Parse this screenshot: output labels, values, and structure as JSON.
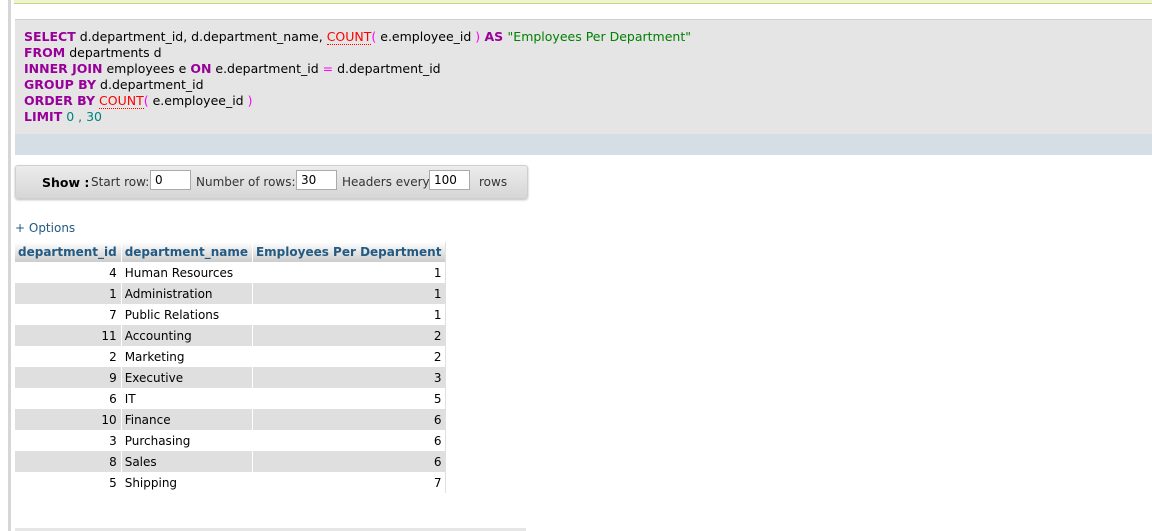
{
  "sql": {
    "line1": {
      "kw_select": "SELECT",
      "cols": " d.department_id, d.department_name, ",
      "fn_count": "COUNT",
      "paren_open": "( ",
      "arg": "e.employee_id",
      "paren_close": " )",
      "kw_as": " AS ",
      "alias": "\"Employees Per Department\""
    },
    "line2": {
      "kw_from": "FROM",
      "rest": " departments d"
    },
    "line3": {
      "kw_inner_join": "INNER JOIN",
      "rest1": " employees e ",
      "kw_on": "ON",
      "rest2": " e.department_id ",
      "op_eq": "=",
      "rest3": " d.department_id"
    },
    "line4": {
      "kw_group_by": "GROUP BY",
      "rest": " d.department_id"
    },
    "line5": {
      "kw_order_by": "ORDER BY",
      "space": " ",
      "fn_count": "COUNT",
      "paren_open": "( ",
      "arg": "e.employee_id",
      "paren_close": " )"
    },
    "line6": {
      "kw_limit": "LIMIT",
      "num_start": " 0",
      "comma": " , ",
      "num_count": "30"
    }
  },
  "navigation": {
    "show_label": "Show :",
    "start_row_label": "Start row:",
    "start_row_value": "0",
    "num_rows_label": "Number of rows:",
    "num_rows_value": "30",
    "headers_every_label": "Headers every",
    "headers_every_value": "100",
    "rows_label": "rows"
  },
  "options_link": "+ Options",
  "table": {
    "headers": [
      "department_id",
      "department_name",
      "Employees Per Department"
    ],
    "rows": [
      [
        "4",
        "Human Resources",
        "1"
      ],
      [
        "1",
        "Administration",
        "1"
      ],
      [
        "7",
        "Public Relations",
        "1"
      ],
      [
        "11",
        "Accounting",
        "2"
      ],
      [
        "2",
        "Marketing",
        "2"
      ],
      [
        "9",
        "Executive",
        "3"
      ],
      [
        "6",
        "IT",
        "5"
      ],
      [
        "10",
        "Finance",
        "6"
      ],
      [
        "3",
        "Purchasing",
        "6"
      ],
      [
        "8",
        "Sales",
        "6"
      ],
      [
        "5",
        "Shipping",
        "7"
      ]
    ]
  },
  "colors": {
    "keyword": "#990099",
    "function": "#ff0000",
    "string": "#008000",
    "number": "#008080",
    "header_text": "#235a81",
    "row_alt": "#dfdfdf"
  }
}
